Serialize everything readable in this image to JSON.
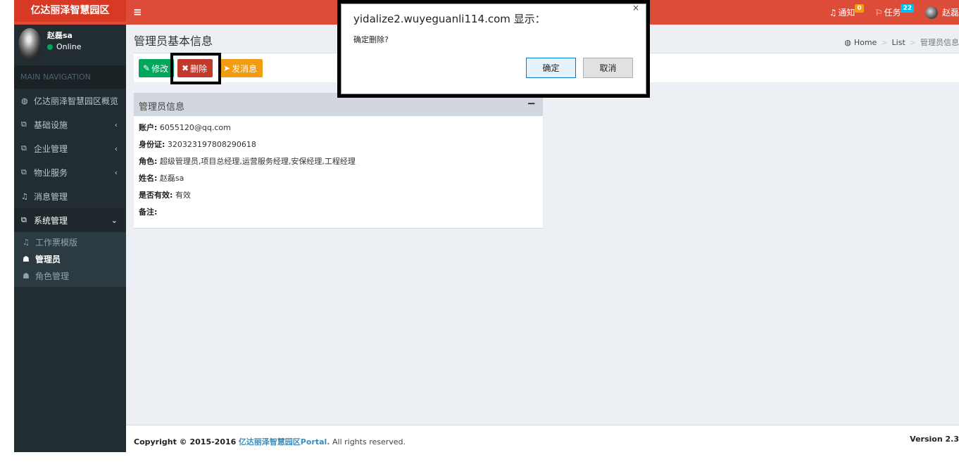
{
  "header": {
    "brand": "亿达丽泽智慧园区",
    "menu_toggle": "≡",
    "notifications": {
      "label": "通知",
      "count": "0"
    },
    "tasks": {
      "label": "任务",
      "count": "22"
    },
    "user_short": "赵磊"
  },
  "sidebar": {
    "user_name": "赵磊sa",
    "status": "Online",
    "nav_header": "MAIN NAVIGATION",
    "items": [
      {
        "label": "亿达丽泽智慧园区概览",
        "icon": "dashboard-icon"
      },
      {
        "label": "基础设施",
        "icon": "copy-icon",
        "chevron": "‹"
      },
      {
        "label": "企业管理",
        "icon": "copy-icon",
        "chevron": "‹"
      },
      {
        "label": "物业服务",
        "icon": "copy-icon",
        "chevron": "‹"
      },
      {
        "label": "消息管理",
        "icon": "bell-icon"
      },
      {
        "label": "系统管理",
        "icon": "copy-icon",
        "chevron": "⌄"
      }
    ],
    "subitems": [
      {
        "label": "工作票模版",
        "icon": "bell-icon"
      },
      {
        "label": "管理员",
        "icon": "user-icon"
      },
      {
        "label": "角色管理",
        "icon": "user-icon"
      }
    ]
  },
  "content": {
    "page_title": "管理员基本信息",
    "breadcrumb": {
      "home": "Home",
      "list": "List",
      "current": "管理员信息"
    },
    "buttons": {
      "edit": "修改",
      "delete": "删除",
      "message": "发消息"
    },
    "box_title": "管理员信息",
    "collapse": "−",
    "fields": [
      {
        "label": "账户:",
        "value": "6055120@qq.com"
      },
      {
        "label": "身份证:",
        "value": "320323197808290618"
      },
      {
        "label": "角色:",
        "value": "超级管理员,项目总经理,运营服务经理,安保经理,工程经理"
      },
      {
        "label": "姓名:",
        "value": "赵磊sa"
      },
      {
        "label": "是否有效:",
        "value": "有效"
      },
      {
        "label": "备注:",
        "value": ""
      }
    ]
  },
  "footer": {
    "copyright": "Copyright © 2015-2016",
    "portal": "亿达丽泽智慧园区Portal.",
    "rights": "All rights reserved.",
    "version": "Version 2.3"
  },
  "dialog": {
    "title": "yidalize2.wuyeguanli114.com 显示：",
    "message": "确定删除?",
    "ok": "确定",
    "cancel": "取消",
    "close": "×"
  }
}
